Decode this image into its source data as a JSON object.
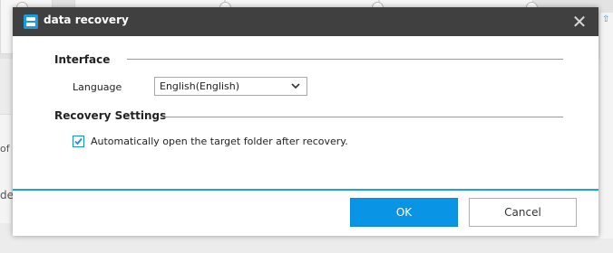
{
  "background": {
    "left_fragment_1": "of",
    "left_fragment_2": "de"
  },
  "dialog": {
    "title": "data recovery",
    "close_glyph": "✕",
    "interface": {
      "section_title": "Interface",
      "language_label": "Language",
      "language_value": "English(English)"
    },
    "recovery_settings": {
      "section_title": "Recovery Settings",
      "auto_open_label": "Automatically open the target folder after recovery.",
      "auto_open_checked": true
    },
    "buttons": {
      "ok_label": "OK",
      "cancel_label": "Cancel"
    }
  },
  "colors": {
    "titlebar": "#404040",
    "accent": "#0a94e6",
    "divider": "#1aa3e6"
  },
  "icons": {
    "app": "data-recovery-icon",
    "close": "close-icon",
    "dropdown": "chevron-down-icon",
    "check": "checkmark-icon"
  }
}
